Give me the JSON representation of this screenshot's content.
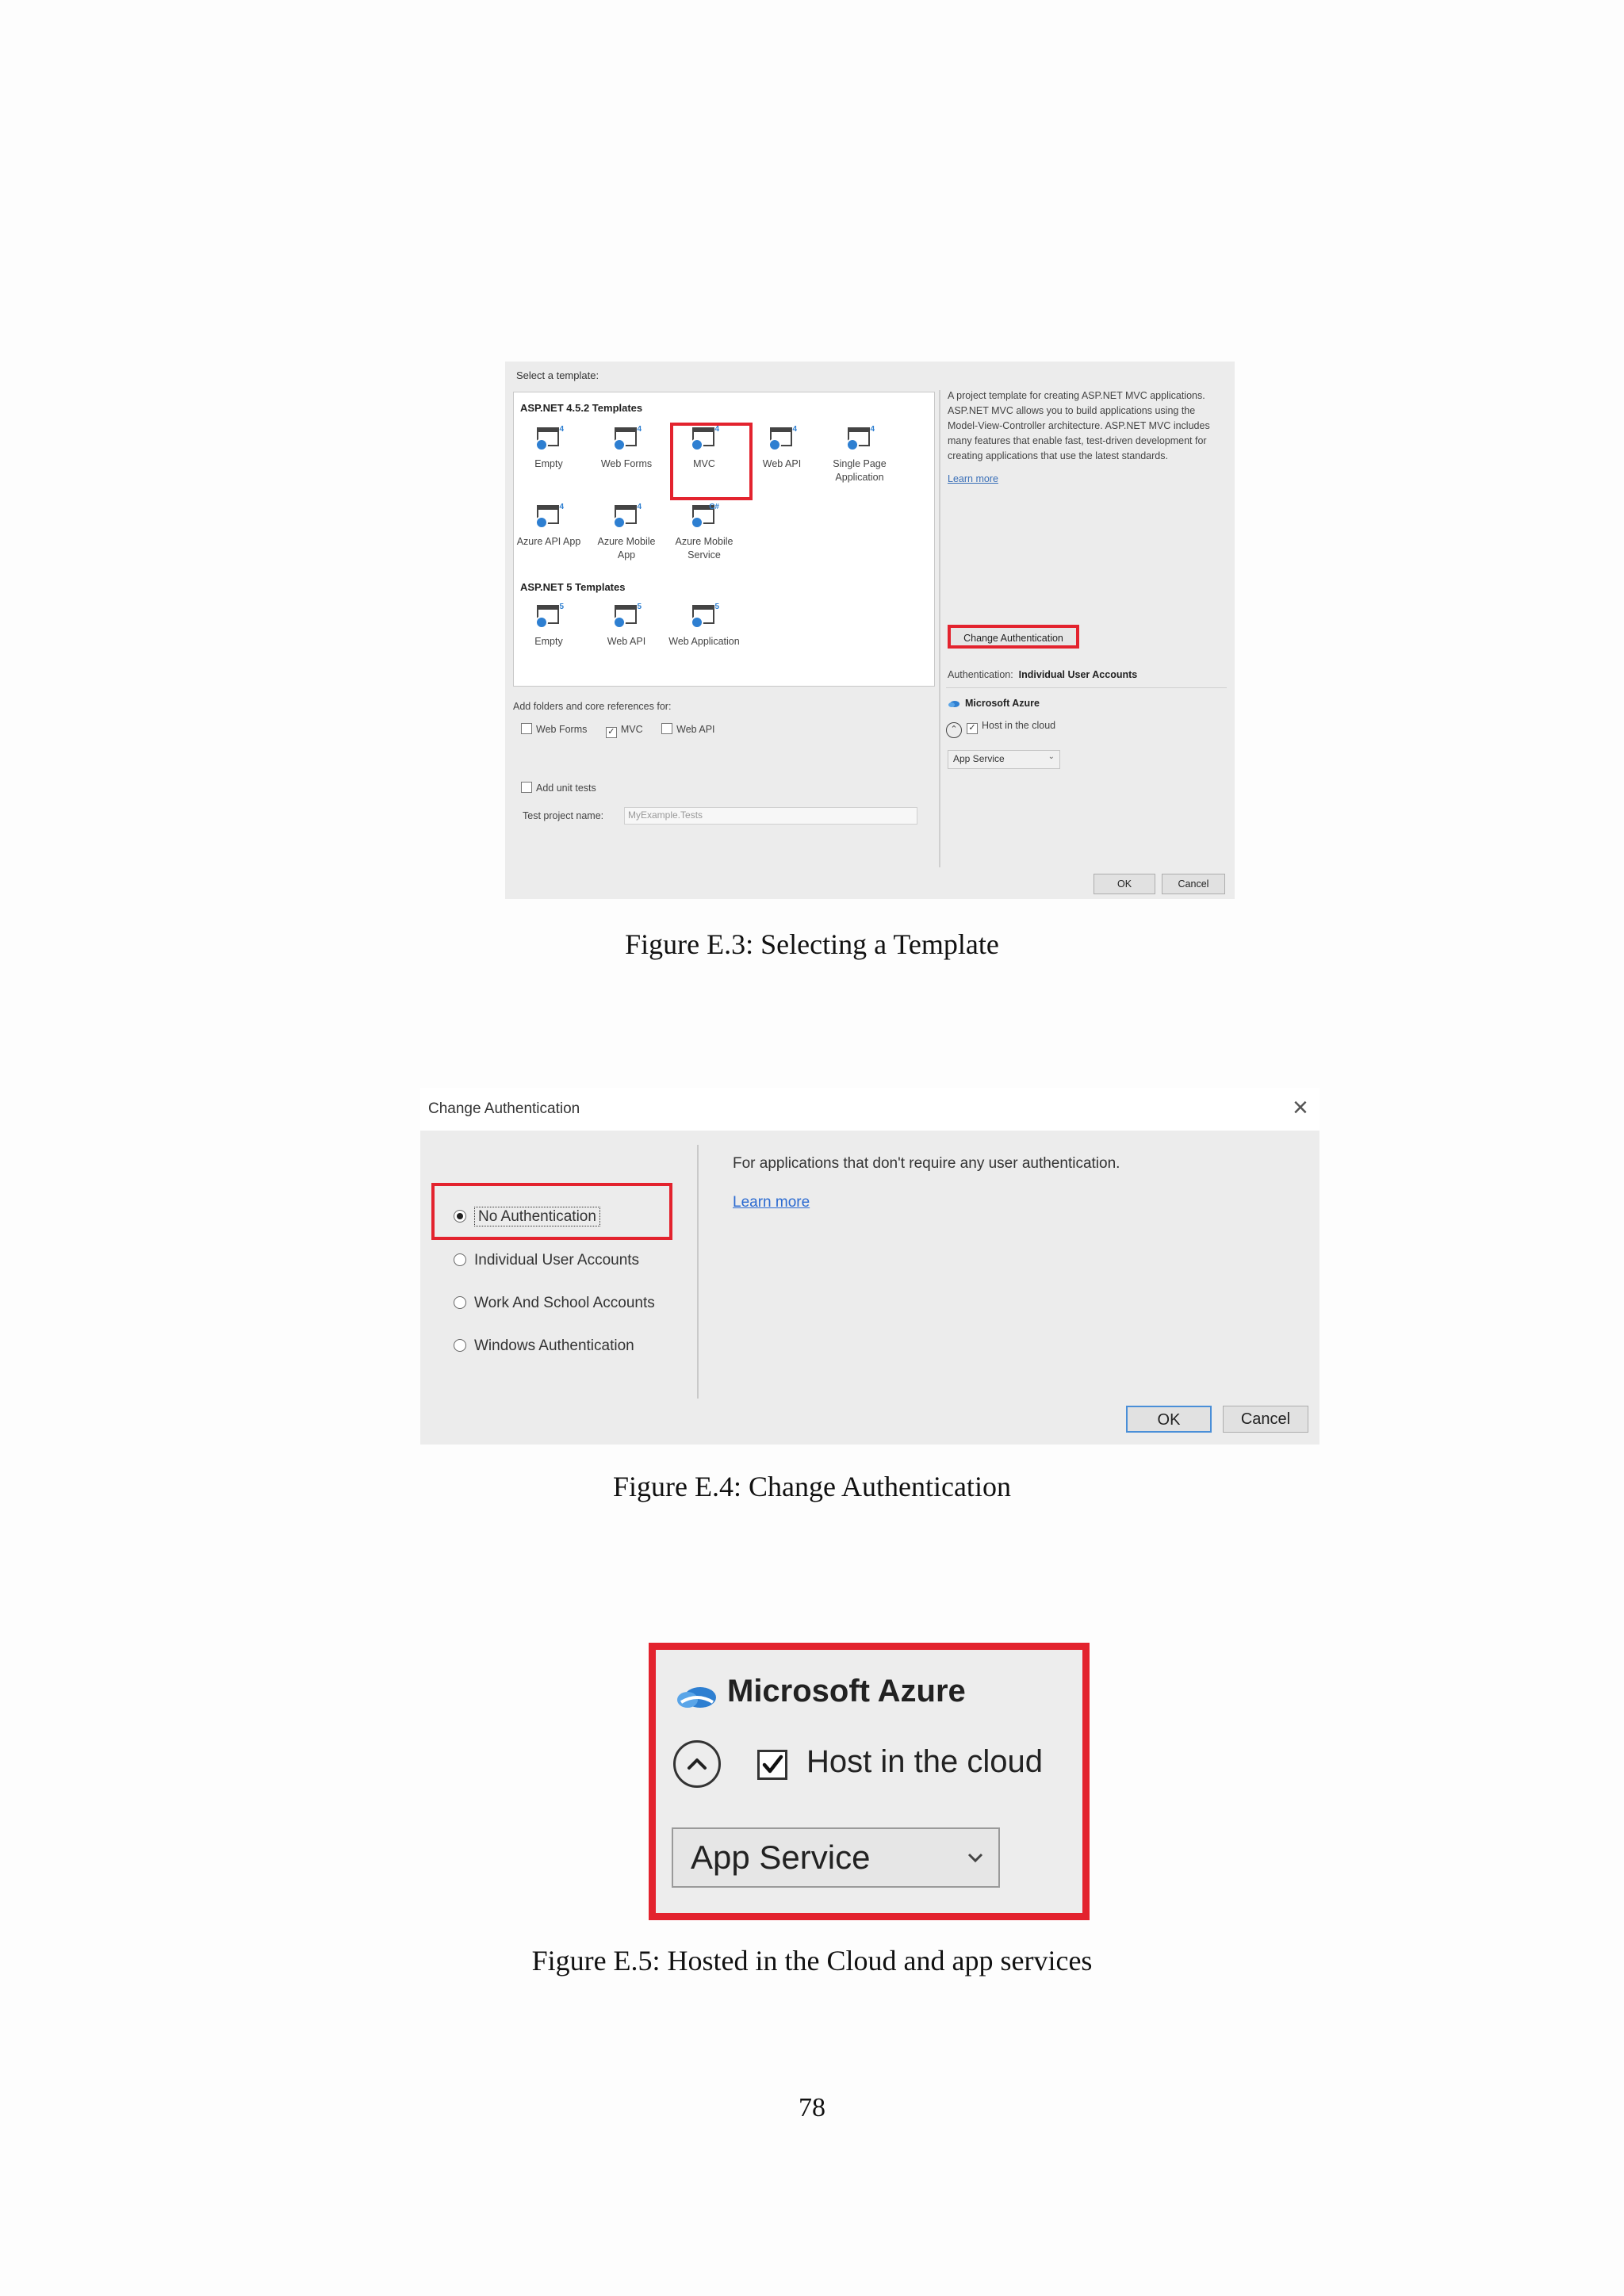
{
  "figure_e3": {
    "select_label": "Select a template:",
    "group1_title": "ASP.NET 4.5.2 Templates",
    "group1_templates": [
      {
        "label": "Empty",
        "ver": "4"
      },
      {
        "label": "Web Forms",
        "ver": "4"
      },
      {
        "label": "MVC",
        "ver": "4"
      },
      {
        "label": "Web API",
        "ver": "4"
      },
      {
        "label": "Single Page Application",
        "ver": "4"
      },
      {
        "label": "Azure API App",
        "ver": "4"
      },
      {
        "label": "Azure Mobile App",
        "ver": "4"
      },
      {
        "label": "Azure Mobile Service",
        "ver": "C#"
      }
    ],
    "group2_title": "ASP.NET 5 Templates",
    "group2_templates": [
      {
        "label": "Empty",
        "ver": "5"
      },
      {
        "label": "Web API",
        "ver": "5"
      },
      {
        "label": "Web Application",
        "ver": "5"
      }
    ],
    "description": "A project template for creating ASP.NET MVC applications. ASP.NET MVC allows you to build applications using the Model-View-Controller architecture. ASP.NET MVC includes many features that enable fast, test-driven development for creating applications that use the latest standards.",
    "learn_more": "Learn more",
    "change_auth_button": "Change Authentication",
    "auth_label": "Authentication:",
    "auth_value": "Individual User Accounts",
    "azure_title": "Microsoft Azure",
    "host_cloud": "Host in the cloud",
    "app_service": "App Service",
    "folders_label": "Add folders and core references for:",
    "folder_options": [
      {
        "label": "Web Forms",
        "checked": false
      },
      {
        "label": "MVC",
        "checked": true
      },
      {
        "label": "Web API",
        "checked": false
      }
    ],
    "unit_tests": "Add unit tests",
    "test_project_label": "Test project name:",
    "test_project_value": "MyExample.Tests",
    "ok": "OK",
    "cancel": "Cancel"
  },
  "caption_e3": "Figure E.3: Selecting a Template",
  "figure_e4": {
    "title": "Change Authentication",
    "close": "×",
    "options": [
      {
        "label": "No Authentication",
        "selected": true
      },
      {
        "label": "Individual User Accounts",
        "selected": false
      },
      {
        "label": "Work And School Accounts",
        "selected": false
      },
      {
        "label": "Windows Authentication",
        "selected": false
      }
    ],
    "description": "For applications that don't require any user authentication.",
    "learn_more": "Learn more",
    "ok": "OK",
    "cancel": "Cancel"
  },
  "caption_e4": "Figure E.4: Change Authentication",
  "figure_e5": {
    "azure_title": "Microsoft Azure",
    "host_cloud": "Host in the cloud",
    "app_service": "App Service"
  },
  "caption_e5": "Figure E.5: Hosted in the Cloud and app services",
  "page_number": "78",
  "colors": {
    "highlight": "#e3232e",
    "link": "#3a6fb7",
    "azure": "#2e7fd1"
  }
}
